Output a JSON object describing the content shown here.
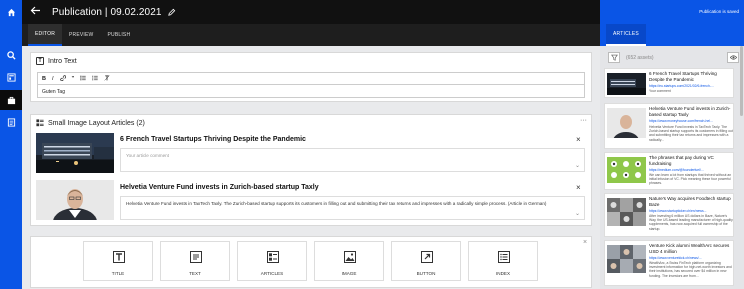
{
  "header": {
    "title": "Publication | 09.02.2021",
    "status": "Publication is saved"
  },
  "tabs": [
    {
      "label": "EDITOR"
    },
    {
      "label": "PREVIEW"
    },
    {
      "label": "PUBLISH"
    }
  ],
  "right_tab": {
    "label": "ARTICLES"
  },
  "intro": {
    "heading": "Intro Text",
    "content": "Guten Tag"
  },
  "toolbar": {
    "bold": "B",
    "italic": "I",
    "link": "🔗",
    "quote": "❞",
    "ul": "☰",
    "ol": "☷",
    "clear": "T̸"
  },
  "articles_block": {
    "heading": "Small Image Layout Articles (2)",
    "more": "···",
    "items": [
      {
        "title": "6 French Travel Startups Thriving Despite the Pandemic",
        "body": "Your article comment"
      },
      {
        "title": "Helvetia Venture Fund invests in Zurich-based startup Taxly",
        "body": "Helvetia Venture Fund invests in TaxTech Taxly. The Zurich-based startup supports its customers in filling out and submitting their tax returns and impresses with a radically simple process. (Article in German)"
      }
    ]
  },
  "blocks": [
    {
      "label": "TITLE",
      "icon": "title-icon"
    },
    {
      "label": "TEXT",
      "icon": "text-icon"
    },
    {
      "label": "ARTICLES",
      "icon": "articles-icon"
    },
    {
      "label": "IMAGE",
      "icon": "image-icon"
    },
    {
      "label": "BUTTON",
      "icon": "button-icon"
    },
    {
      "label": "INDEX",
      "icon": "index-icon"
    }
  ],
  "assets_panel": {
    "count": "(652 assets)"
  },
  "assets": [
    {
      "title": "6 French Travel Startups Thriving Despite the Pandemic",
      "url": "https://eu.startups.com/2021/02/6-french-...",
      "desc": "Your comment"
    },
    {
      "title": "Helvetia Venture Fund invests in Zurich-based startup Taxly",
      "url": "https://www.moneyhouse.com/french-hel...",
      "desc": "Helvetia Venture Fund invests in TaxTech Taxly. The Zurich-based startup supports its customers in filling out and submitting their tax returns and impresses with a radically..."
    },
    {
      "title": "The phrases that pay during VC fundraising",
      "url": "https://medium.com/@founderfuel/...",
      "desc": "We can learn a lot from startups that thrived without an initial infusion of VC. Pick meaning these four powerful phrases."
    },
    {
      "title": "Nature's Way acquires Foodtech startup Baze",
      "url": "https://www.startupticker.ch/en/news...",
      "desc": "After investing 6 million US dollars in Baze, Nature's Way, the US-based leading manufacturer of high-quality supplements, has now acquired full ownership of the startup."
    },
    {
      "title": "Venture Kick alumni WealthArc secures USD 4 million",
      "url": "https://www.venturekick.ch/news/...",
      "desc": "WealthArc, a Swiss FinTech platform organizing investment information for high-net-worth investors and their institutions, has secured over $4 million in new funding. The investors are from..."
    }
  ],
  "colors": {
    "brand": "#0a55e6",
    "dark": "#111111"
  }
}
